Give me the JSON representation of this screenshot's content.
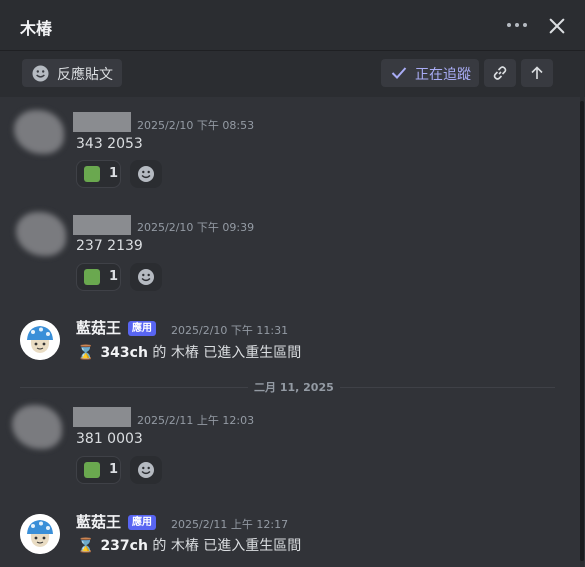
{
  "header": {
    "title": "木椿"
  },
  "toolbar": {
    "react_label": "反應貼文",
    "follow_label": "正在追蹤"
  },
  "messages": [
    {
      "timestamp": "2025/2/10 下午 08:53",
      "text": "343 2053",
      "reaction_count": "1"
    },
    {
      "timestamp": "2025/2/10 下午 09:39",
      "text": "237 2139",
      "reaction_count": "1"
    },
    {
      "username": "藍菇王",
      "tag": "應用",
      "timestamp": "2025/2/10 下午 11:31",
      "emoji": "⌛",
      "strong": "343ch",
      "text_a": " 的 ",
      "target": "木樁",
      "text_b": " 已進入重生區間"
    },
    {
      "timestamp": "2025/2/11 上午 12:03",
      "text": "381 0003",
      "reaction_count": "1"
    },
    {
      "username": "藍菇王",
      "tag": "應用",
      "timestamp": "2025/2/11 上午 12:17",
      "emoji": "⌛",
      "strong": "237ch",
      "text_a": " 的 ",
      "target": "木樁",
      "text_b": " 已進入重生區間"
    }
  ],
  "divider": {
    "label": "二月 11, 2025"
  },
  "colors": {
    "accent": "#5865f2",
    "reaction_square": "#6aa84f",
    "background": "#313338"
  }
}
